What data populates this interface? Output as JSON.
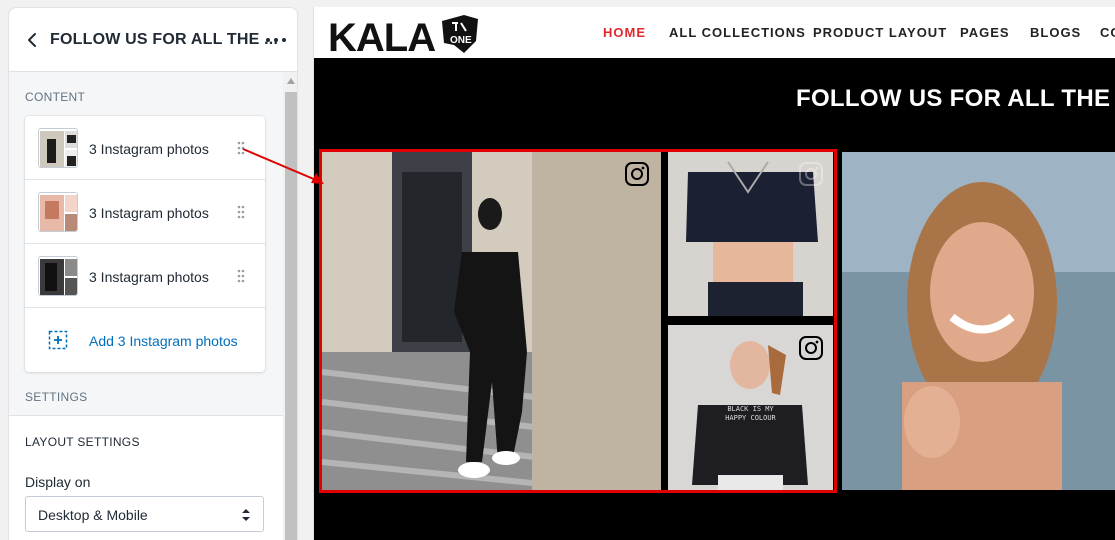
{
  "panel": {
    "title": "FOLLOW US FOR ALL THE ...",
    "content_label": "CONTENT",
    "blocks": [
      {
        "label": "3 Instagram photos"
      },
      {
        "label": "3 Instagram photos"
      },
      {
        "label": "3 Instagram photos"
      }
    ],
    "add_block_label": "Add 3 Instagram photos",
    "settings_label": "SETTINGS",
    "layout_settings_heading": "LAYOUT SETTINGS",
    "display_on_label": "Display on",
    "display_on_value": "Desktop & Mobile"
  },
  "preview": {
    "logo_text": "KALA",
    "logo_badge": "ONE",
    "nav": [
      "HOME",
      "ALL COLLECTIONS",
      "PRODUCT LAYOUT",
      "PAGES",
      "BLOGS",
      "CO"
    ],
    "active_nav": "HOME",
    "section_heading": "FOLLOW US FOR ALL THE FAS",
    "shirt_text": "BLACK IS MY\nHAPPY COLOUR"
  },
  "colors": {
    "accent_link": "#006fbb",
    "nav_active": "#e0282e",
    "selection": "#e00000",
    "preview_bg": "#000000"
  },
  "icons": [
    "chevron-left-icon",
    "more-horizontal-icon",
    "drag-handle-icon",
    "add-block-icon",
    "select-arrows-icon",
    "instagram-icon",
    "scroll-up-icon"
  ]
}
